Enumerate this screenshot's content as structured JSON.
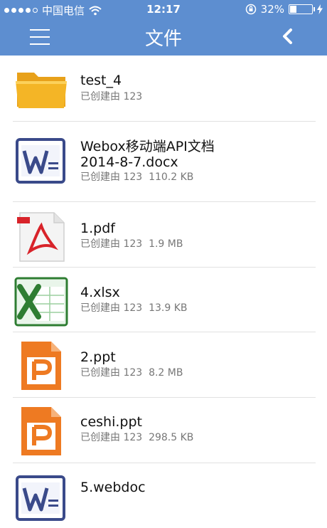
{
  "status_bar": {
    "carrier": "中国电信",
    "time": "12:17",
    "battery_percent": "32%",
    "battery_level": 0.32,
    "signal_bars": 4
  },
  "nav": {
    "title": "文件",
    "menu_icon": "hamburger-menu-icon",
    "back_icon": "chevron-left-icon"
  },
  "files": [
    {
      "name": "test_4",
      "creator": "已创建由 123",
      "size": "",
      "icon": "folder-icon"
    },
    {
      "name": "Webox移动端API文档\n2014-8-7.docx",
      "creator": "已创建由 123",
      "size": "110.2 KB",
      "icon": "word-doc-icon"
    },
    {
      "name": "1.pdf",
      "creator": "已创建由 123",
      "size": "1.9 MB",
      "icon": "pdf-icon"
    },
    {
      "name": "4.xlsx",
      "creator": "已创建由 123",
      "size": "13.9 KB",
      "icon": "excel-icon"
    },
    {
      "name": "2.ppt",
      "creator": "已创建由 123",
      "size": "8.2 MB",
      "icon": "ppt-icon"
    },
    {
      "name": "ceshi.ppt",
      "creator": "已创建由 123",
      "size": "298.5 KB",
      "icon": "ppt-icon"
    },
    {
      "name": "5.webdoc",
      "creator": "",
      "size": "",
      "icon": "word-doc-icon"
    }
  ],
  "colors": {
    "header": "#5d8ed0",
    "folder": "#f4b526",
    "word": "#3a4a8a",
    "pdf": "#d8232a",
    "excel": "#2e7d32",
    "ppt": "#ee7a22"
  }
}
